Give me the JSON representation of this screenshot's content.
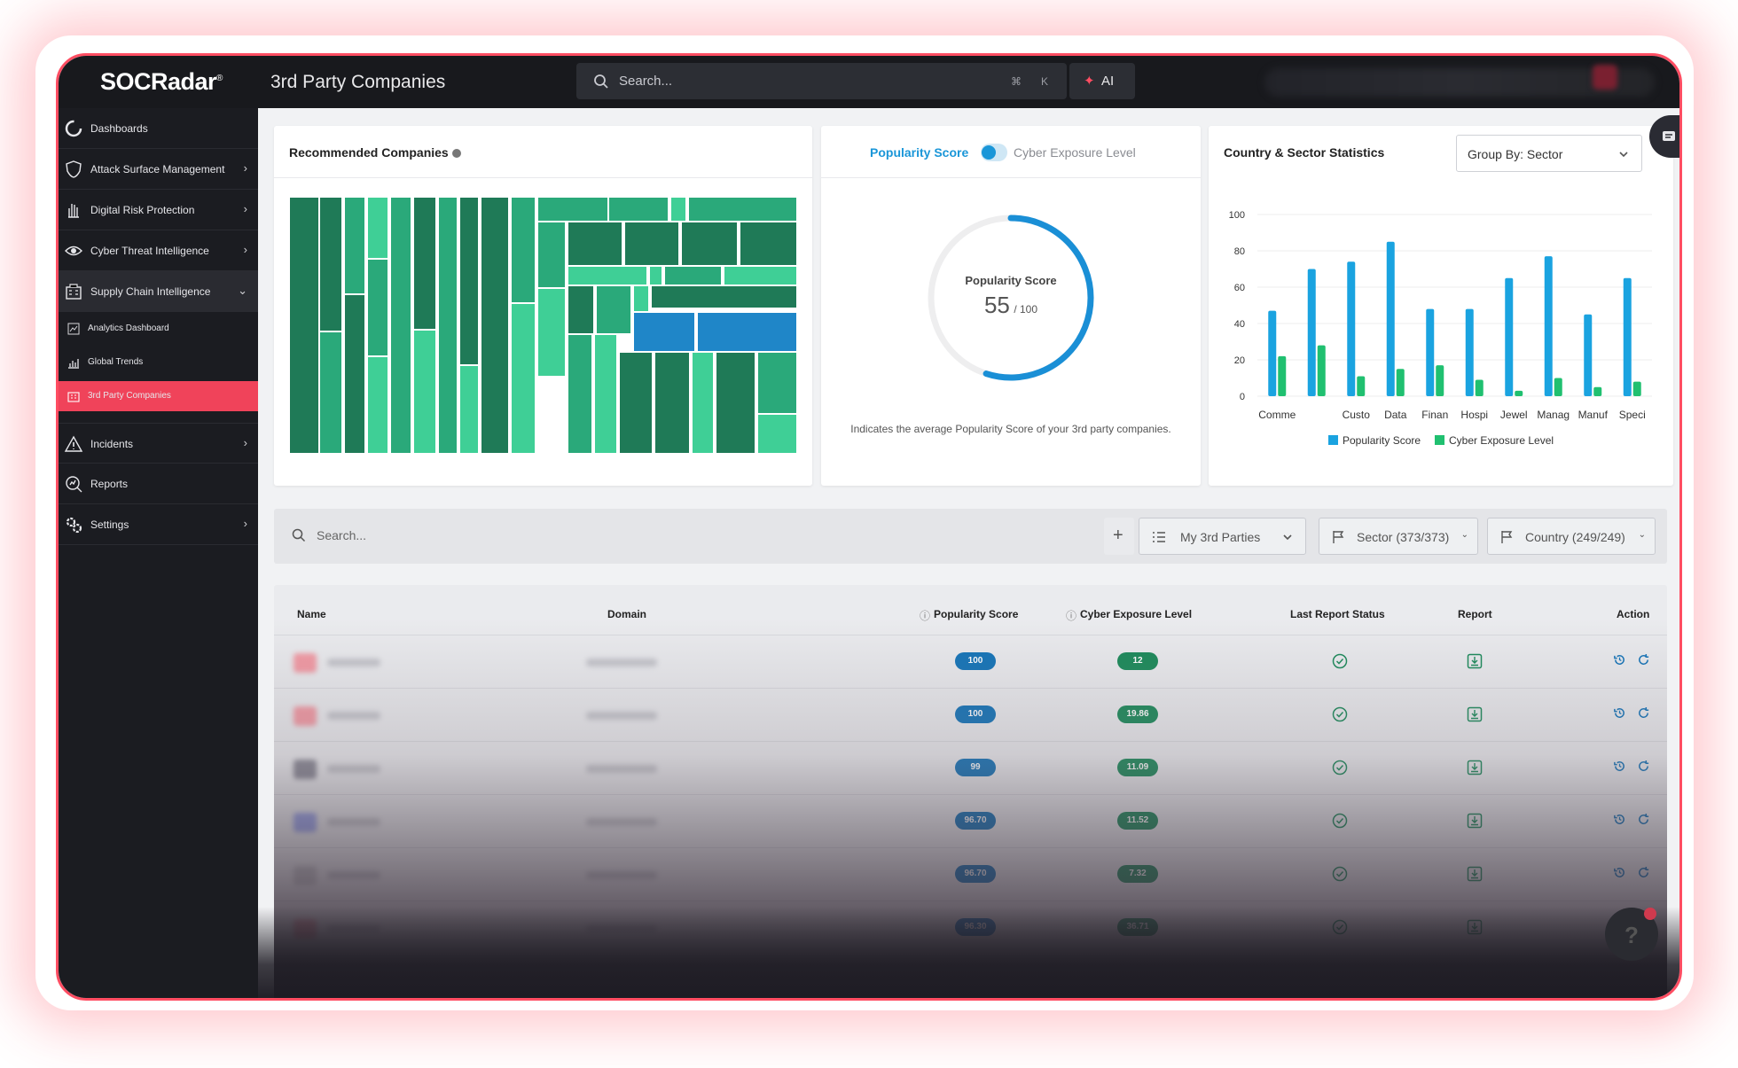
{
  "app": {
    "logo": "SOCRadar",
    "page_title": "3rd Party Companies"
  },
  "topbar": {
    "search_placeholder": "Search...",
    "kbd_cmd": "⌘",
    "kbd_k": "K",
    "ai_label": "AI"
  },
  "sidebar": {
    "items": [
      {
        "label": "Dashboards",
        "icon": "dashboard-icon",
        "chevron": ""
      },
      {
        "label": "Attack Surface Management",
        "icon": "shield-icon",
        "chevron": "›"
      },
      {
        "label": "Digital Risk Protection",
        "icon": "hand-icon",
        "chevron": "›"
      },
      {
        "label": "Cyber Threat Intelligence",
        "icon": "eye-icon",
        "chevron": "›"
      },
      {
        "label": "Supply Chain Intelligence",
        "icon": "building-icon",
        "chevron": "⌄"
      },
      {
        "label": "Incidents",
        "icon": "alert-icon",
        "chevron": "›"
      },
      {
        "label": "Reports",
        "icon": "report-icon",
        "chevron": ""
      },
      {
        "label": "Settings",
        "icon": "gear-icon",
        "chevron": "›"
      }
    ],
    "subitems": [
      {
        "label": "Analytics Dashboard",
        "icon": "analytics-icon",
        "active": false
      },
      {
        "label": "Global Trends",
        "icon": "trends-icon",
        "active": false
      },
      {
        "label": "3rd Party Companies",
        "icon": "companies-icon",
        "active": true
      }
    ]
  },
  "recommended": {
    "title": "Recommended Companies",
    "colors": {
      "dark": "#1f7a57",
      "mid": "#2aa97a",
      "light": "#3fcf96",
      "blue": "#1f86c8"
    }
  },
  "popularity": {
    "toggle_on_label": "Popularity Score",
    "toggle_off_label": "Cyber Exposure Level",
    "gauge_title": "Popularity Score",
    "gauge_value": "55",
    "gauge_max": "/ 100",
    "score_fraction": 0.55,
    "caption": "Indicates the average Popularity Score of your 3rd party companies."
  },
  "stats": {
    "title": "Country & Sector Statistics",
    "group_by": "Group By: Sector"
  },
  "chart_data": {
    "type": "bar",
    "title": "",
    "xlabel": "",
    "ylabel": "",
    "ylim": [
      0,
      100
    ],
    "yticks": [
      0,
      20,
      40,
      60,
      80,
      100
    ],
    "categories": [
      "Comme",
      "",
      "Custo",
      "Data",
      "Finan",
      "Hospi",
      "Jewel",
      "Manag",
      "Manuf",
      "Speci"
    ],
    "series": [
      {
        "name": "Popularity Score",
        "color": "#1aa3e0",
        "values": [
          47,
          70,
          74,
          85,
          48,
          48,
          65,
          77,
          45,
          65
        ]
      },
      {
        "name": "Cyber Exposure Level",
        "color": "#20c070",
        "values": [
          22,
          28,
          11,
          15,
          17,
          9,
          3,
          10,
          5,
          8
        ]
      }
    ],
    "grid": true,
    "legend": "bottom"
  },
  "filterbar": {
    "search_placeholder": "Search...",
    "add_label": "+",
    "my_parties": "My 3rd Parties",
    "sector": "Sector (373/373)",
    "country": "Country (249/249)"
  },
  "table": {
    "columns": [
      "Name",
      "Domain",
      "Popularity Score",
      "Cyber Exposure Level",
      "Last Report Status",
      "Report",
      "Action"
    ],
    "rows": [
      {
        "popularity": "100",
        "exposure": "12"
      },
      {
        "popularity": "100",
        "exposure": "19.86"
      },
      {
        "popularity": "99",
        "exposure": "11.09"
      },
      {
        "popularity": "96.70",
        "exposure": "11.52"
      },
      {
        "popularity": "96.70",
        "exposure": "7.32"
      },
      {
        "popularity": "96.30",
        "exposure": "36.71"
      }
    ]
  }
}
